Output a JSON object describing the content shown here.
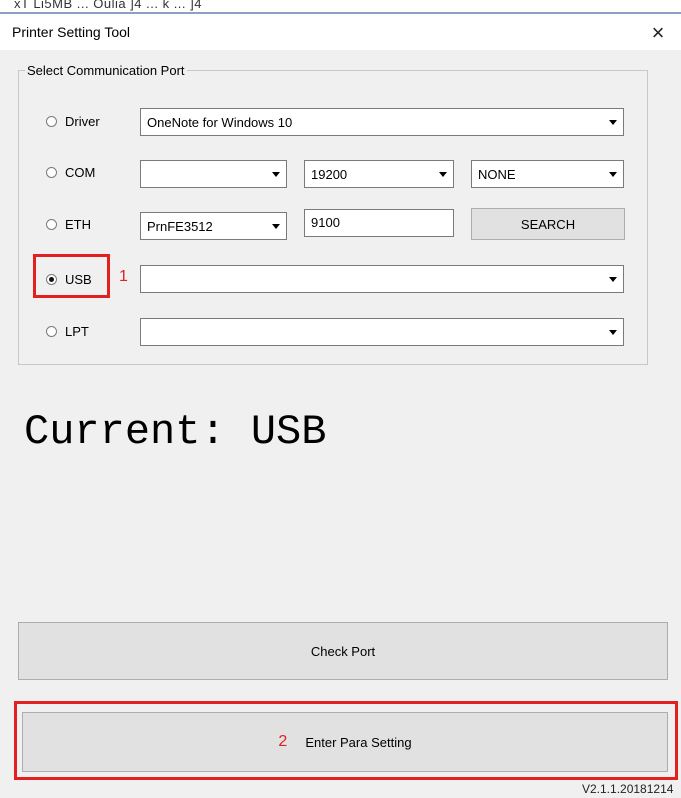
{
  "window": {
    "title": "Printer Setting Tool",
    "close_label": "×",
    "background_title_fragment": "xT   Li5MB ...  Oulia  ]4   ...  k    ... ]4"
  },
  "port_group": {
    "legend": "Select Communication Port",
    "driver": {
      "label": "Driver",
      "selected": false,
      "value": "OneNote for Windows 10"
    },
    "com": {
      "label": "COM",
      "selected": false,
      "port": "",
      "baud": "19200",
      "parity": "NONE"
    },
    "eth": {
      "label": "ETH",
      "selected": false,
      "printer": "PrnFE3512",
      "port": "9100",
      "search_label": "SEARCH"
    },
    "usb": {
      "label": "USB",
      "selected": true,
      "value": ""
    },
    "lpt": {
      "label": "LPT",
      "selected": false,
      "value": ""
    }
  },
  "annotations": {
    "step1": "1",
    "step2": "2",
    "highlight_color": "#e32020"
  },
  "current_port": "Current: USB",
  "buttons": {
    "check_port": "Check Port",
    "enter_para_setting": "Enter Para Setting"
  },
  "version": "V2.1.1.20181214"
}
